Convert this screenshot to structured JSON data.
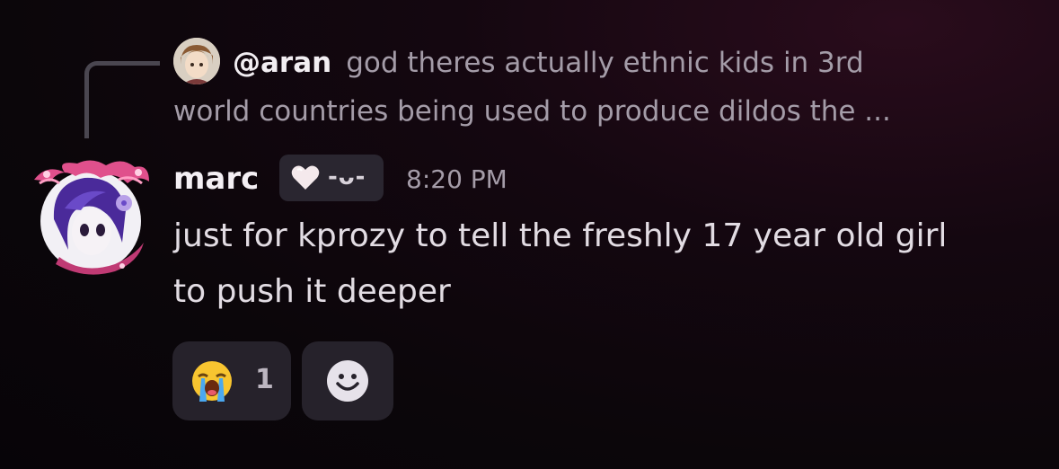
{
  "reply": {
    "username": "@aran",
    "text_line1": "god theres actually ethnic kids in 3rd",
    "text_line2": "world countries being used to produce dildos the ...",
    "avatar_icon": "reply-avatar-icon"
  },
  "message": {
    "username": "marc",
    "tag": "-ᴗ-",
    "tag_icon": "heart-icon",
    "timestamp": "8:20 PM",
    "lines": [
      "just for kprozy to tell the freshly 17 year old girl",
      "to push it deeper"
    ],
    "avatar_icon": "user-avatar-icon"
  },
  "reactions": [
    {
      "emoji": "😭",
      "icon": "loudly-crying-face-icon",
      "count": "1"
    }
  ],
  "add_reaction_icon": "add-reaction-smiley-icon",
  "colors": {
    "background": "#0b060a",
    "muted_text": "#a49ca8",
    "reaction_bg": "#26222b"
  }
}
